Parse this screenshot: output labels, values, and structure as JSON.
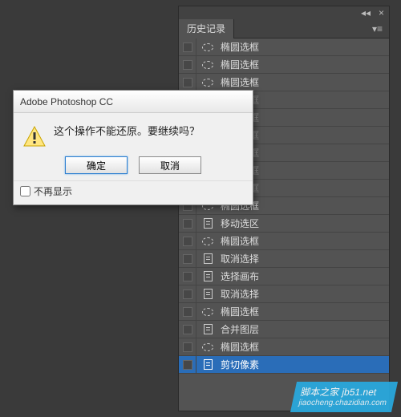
{
  "panel": {
    "title": "历史记录",
    "history": [
      {
        "icon": "ellipse",
        "label": "椭圆选框",
        "state": "normal"
      },
      {
        "icon": "ellipse",
        "label": "椭圆选框",
        "state": "normal"
      },
      {
        "icon": "ellipse",
        "label": "椭圆选框",
        "state": "normal"
      },
      {
        "icon": "ellipse",
        "label": "椭圆选框",
        "state": "dim"
      },
      {
        "icon": "ellipse",
        "label": "椭圆选框",
        "state": "dim"
      },
      {
        "icon": "ellipse",
        "label": "椭圆选框",
        "state": "dim"
      },
      {
        "icon": "ellipse",
        "label": "椭圆选框",
        "state": "dim"
      },
      {
        "icon": "ellipse",
        "label": "椭圆选框",
        "state": "dim"
      },
      {
        "icon": "ellipse",
        "label": "椭圆选框",
        "state": "dim"
      },
      {
        "icon": "ellipse",
        "label": "椭圆选框",
        "state": "normal"
      },
      {
        "icon": "doc",
        "label": "移动选区",
        "state": "normal"
      },
      {
        "icon": "ellipse",
        "label": "椭圆选框",
        "state": "normal"
      },
      {
        "icon": "doc",
        "label": "取消选择",
        "state": "normal"
      },
      {
        "icon": "doc",
        "label": "选择画布",
        "state": "normal"
      },
      {
        "icon": "doc",
        "label": "取消选择",
        "state": "normal"
      },
      {
        "icon": "ellipse",
        "label": "椭圆选框",
        "state": "normal"
      },
      {
        "icon": "doc",
        "label": "合并图层",
        "state": "normal"
      },
      {
        "icon": "ellipse",
        "label": "椭圆选框",
        "state": "normal"
      },
      {
        "icon": "doc",
        "label": "剪切像素",
        "state": "active"
      }
    ]
  },
  "dialog": {
    "title": "Adobe Photoshop CC",
    "message": "这个操作不能还原。要继续吗？",
    "ok_label": "确定",
    "cancel_label": "取消",
    "dont_show_label": "不再显示"
  },
  "watermark": {
    "line1": "脚本之家 jb51.net",
    "line2": "jiaocheng.chazidian.com"
  }
}
